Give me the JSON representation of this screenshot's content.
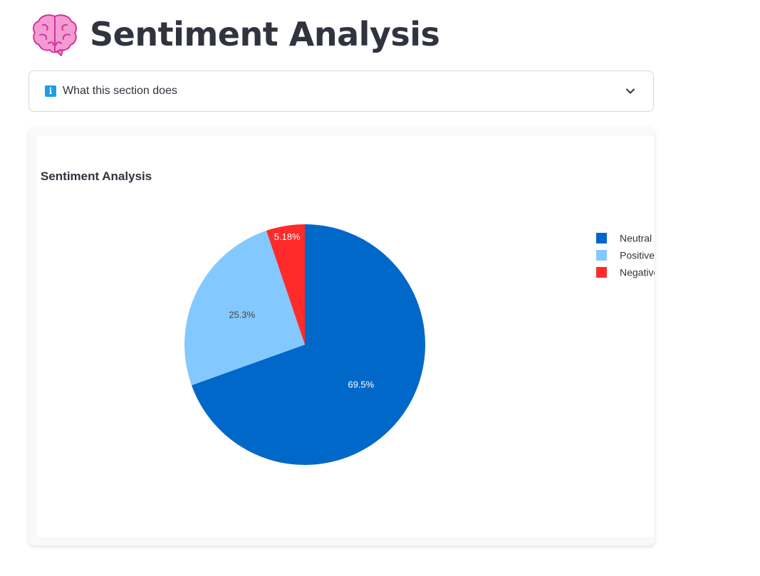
{
  "header": {
    "title": "Sentiment Analysis",
    "icon": "brain-icon"
  },
  "expander": {
    "label": "What this section does",
    "icon": "info-icon",
    "toggle_icon": "chevron-down-icon",
    "expanded": false
  },
  "colors": {
    "neutral": "#0068c9",
    "positive": "#83c9ff",
    "negative": "#ff2b2b"
  },
  "chart_data": {
    "type": "pie",
    "title": "Sentiment Analysis",
    "categories": [
      "Neutral",
      "Positive",
      "Negative"
    ],
    "values": [
      69.5,
      25.3,
      5.18
    ],
    "labels": [
      "69.5%",
      "25.3%",
      "5.18%"
    ],
    "colors": [
      "#0068c9",
      "#83c9ff",
      "#ff2b2b"
    ],
    "legend": {
      "placement": "top-right",
      "entries": [
        "Neutral",
        "Positive",
        "Negative"
      ]
    }
  }
}
